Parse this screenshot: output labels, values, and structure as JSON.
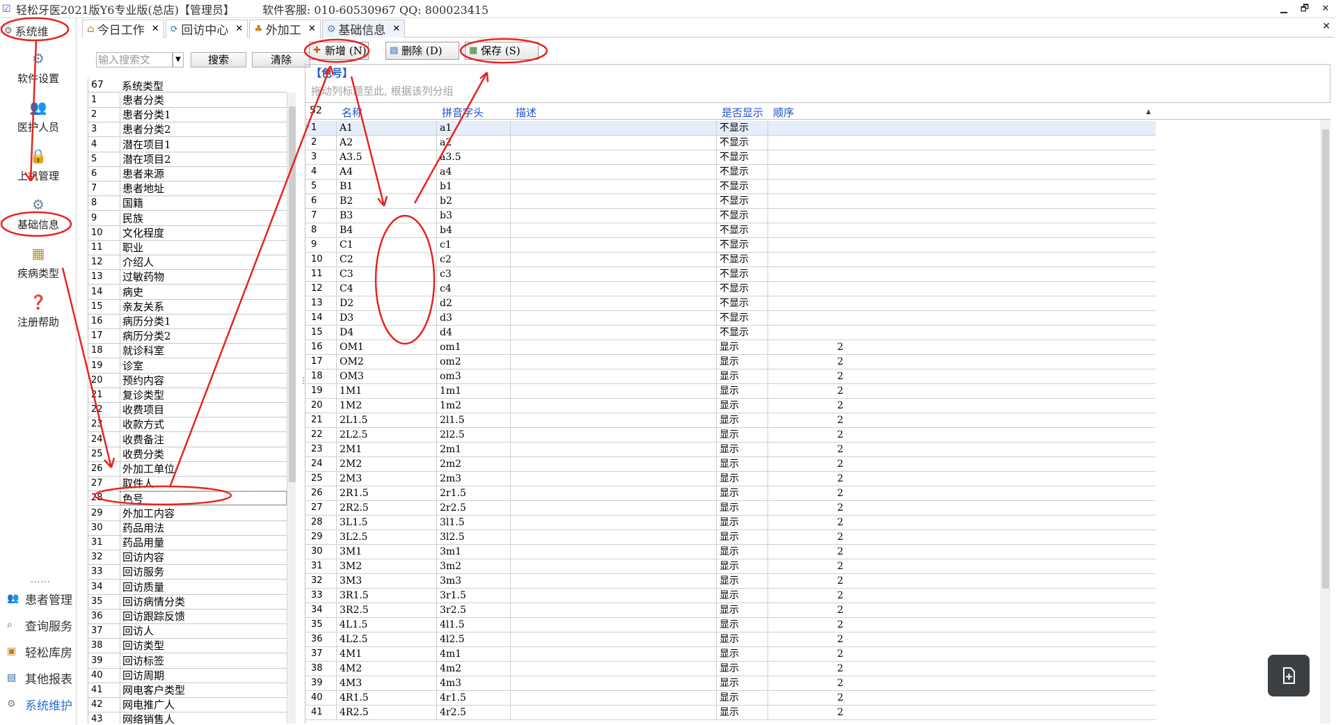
{
  "window": {
    "title": "轻松牙医2021版Y6专业版(总店)【管理员】",
    "support": "软件客服: 010-60530967  QQ: 800023415",
    "minimize": "▁",
    "restore": "🗗",
    "close": "✕"
  },
  "leftnav": {
    "section_title": "系统维",
    "items": [
      {
        "label": "软件设置",
        "icon": "gear-icon"
      },
      {
        "label": "医护人员",
        "icon": "people-icon"
      },
      {
        "label": "上机管理",
        "icon": "lock-icon"
      },
      {
        "label": "基础信息",
        "icon": "settings-gear-icon"
      },
      {
        "label": "疾病类型",
        "icon": "tree-icon"
      },
      {
        "label": "注册帮助",
        "icon": "help-icon"
      }
    ],
    "dots": "......",
    "menu": [
      {
        "label": "患者管理",
        "icon": "people-icon"
      },
      {
        "label": "查询服务",
        "icon": "search-icon"
      },
      {
        "label": "轻松库房",
        "icon": "box-icon"
      },
      {
        "label": "其他报表",
        "icon": "report-icon"
      },
      {
        "label": "系统维护",
        "icon": "gear-icon"
      }
    ],
    "chevron": "⌄"
  },
  "tabs": [
    {
      "label": "今日工作",
      "close": "✕"
    },
    {
      "label": "回访中心",
      "close": "✕"
    },
    {
      "label": "外加工",
      "close": "✕"
    },
    {
      "label": "基础信息",
      "close": "✕"
    }
  ],
  "close_all": "✕",
  "search": {
    "placeholder": "输入搜索文",
    "search_button": "搜索",
    "clear_button": "清除"
  },
  "type_grid": {
    "count": "67",
    "header": "系统类型",
    "selected_index": 28,
    "rows": [
      "患者分类",
      "患者分类1",
      "患者分类2",
      "潜在项目1",
      "潜在项目2",
      "患者来源",
      "患者地址",
      "国籍",
      "民族",
      "文化程度",
      "职业",
      "介绍人",
      "过敏药物",
      "病史",
      "亲友关系",
      "病历分类1",
      "病历分类2",
      "就诊科室",
      "诊室",
      "预约内容",
      "复诊类型",
      "收费项目",
      "收款方式",
      "收费备注",
      "收费分类",
      "外加工单位",
      "取件人",
      "色号",
      "外加工内容",
      "药品用法",
      "药品用量",
      "回访内容",
      "回访服务",
      "回访质量",
      "回访病情分类",
      "回访跟踪反馈",
      "回访人",
      "回访类型",
      "回访标签",
      "回访周期",
      "网电客户类型",
      "网电推广人",
      "网络销售人"
    ]
  },
  "toolbar": {
    "add": "新增 (N)",
    "delete": "删除 (D)",
    "save": "保存 (S)"
  },
  "group": {
    "title": "【色号】",
    "hint": "拖动列标题至此, 根据该列分组"
  },
  "color_grid": {
    "count": "52",
    "headers": {
      "name": "名称",
      "pinyin": "拼音字头",
      "desc": "描述",
      "show": "是否显示",
      "order": "顺序"
    },
    "rows": [
      [
        "A1",
        "a1",
        "不显示",
        ""
      ],
      [
        "A2",
        "a2",
        "不显示",
        ""
      ],
      [
        "A3.5",
        "a3.5",
        "不显示",
        ""
      ],
      [
        "A4",
        "a4",
        "不显示",
        ""
      ],
      [
        "B1",
        "b1",
        "不显示",
        ""
      ],
      [
        "B2",
        "b2",
        "不显示",
        ""
      ],
      [
        "B3",
        "b3",
        "不显示",
        ""
      ],
      [
        "B4",
        "b4",
        "不显示",
        ""
      ],
      [
        "C1",
        "c1",
        "不显示",
        ""
      ],
      [
        "C2",
        "c2",
        "不显示",
        ""
      ],
      [
        "C3",
        "c3",
        "不显示",
        ""
      ],
      [
        "C4",
        "c4",
        "不显示",
        ""
      ],
      [
        "D2",
        "d2",
        "不显示",
        ""
      ],
      [
        "D3",
        "d3",
        "不显示",
        ""
      ],
      [
        "D4",
        "d4",
        "不显示",
        ""
      ],
      [
        "OM1",
        "om1",
        "显示",
        "2"
      ],
      [
        "OM2",
        "om2",
        "显示",
        "2"
      ],
      [
        "OM3",
        "om3",
        "显示",
        "2"
      ],
      [
        "1M1",
        "1m1",
        "显示",
        "2"
      ],
      [
        "1M2",
        "1m2",
        "显示",
        "2"
      ],
      [
        "2L1.5",
        "2l1.5",
        "显示",
        "2"
      ],
      [
        "2L2.5",
        "2l2.5",
        "显示",
        "2"
      ],
      [
        "2M1",
        "2m1",
        "显示",
        "2"
      ],
      [
        "2M2",
        "2m2",
        "显示",
        "2"
      ],
      [
        "2M3",
        "2m3",
        "显示",
        "2"
      ],
      [
        "2R1.5",
        "2r1.5",
        "显示",
        "2"
      ],
      [
        "2R2.5",
        "2r2.5",
        "显示",
        "2"
      ],
      [
        "3L1.5",
        "3l1.5",
        "显示",
        "2"
      ],
      [
        "3L2.5",
        "3l2.5",
        "显示",
        "2"
      ],
      [
        "3M1",
        "3m1",
        "显示",
        "2"
      ],
      [
        "3M2",
        "3m2",
        "显示",
        "2"
      ],
      [
        "3M3",
        "3m3",
        "显示",
        "2"
      ],
      [
        "3R1.5",
        "3r1.5",
        "显示",
        "2"
      ],
      [
        "3R2.5",
        "3r2.5",
        "显示",
        "2"
      ],
      [
        "4L1.5",
        "4l1.5",
        "显示",
        "2"
      ],
      [
        "4L2.5",
        "4l2.5",
        "显示",
        "2"
      ],
      [
        "4M1",
        "4m1",
        "显示",
        "2"
      ],
      [
        "4M2",
        "4m2",
        "显示",
        "2"
      ],
      [
        "4M3",
        "4m3",
        "显示",
        "2"
      ],
      [
        "4R1.5",
        "4r1.5",
        "显示",
        "2"
      ],
      [
        "4R2.5",
        "4r2.5",
        "显示",
        "2"
      ]
    ]
  },
  "colors": {
    "accent_blue": "#1f4fd0",
    "annotation_red": "#e8231f",
    "selected_row": "#e6eefb"
  }
}
